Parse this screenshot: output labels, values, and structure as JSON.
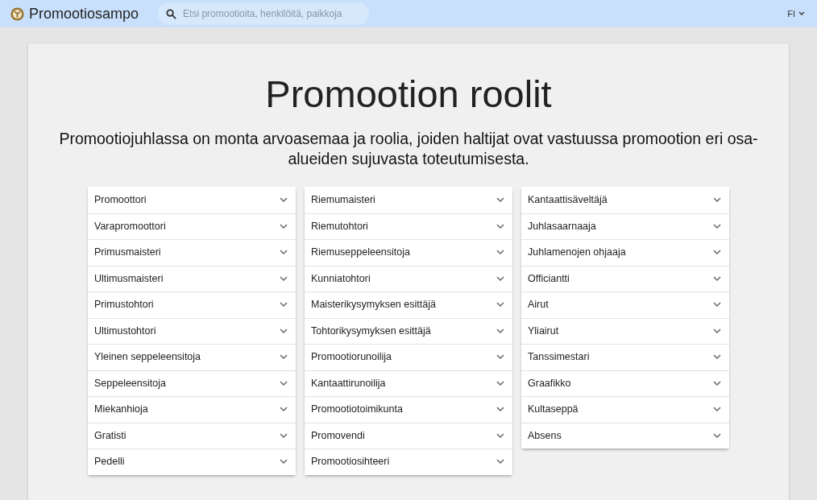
{
  "app_bar": {
    "title": "Promootiosampo",
    "search": {
      "placeholder": "Etsi promootioita, henkilöitä, paikkoja"
    },
    "language": "FI"
  },
  "heading": "Promootion roolit",
  "intro": "Promootiojuhlassa on monta arvoasemaa ja roolia, joiden haltijat ovat vastuussa promootion eri osa-alueiden sujuvasta toteutumisesta.",
  "columns": [
    {
      "items": [
        {
          "label": "Promoottori",
          "expanded": false
        },
        {
          "label": "Varapromoottori",
          "expanded": false
        },
        {
          "label": "Primusmaisteri",
          "expanded": false
        },
        {
          "label": "Ultimusmaisteri",
          "expanded": false
        },
        {
          "label": "Primustohtori",
          "expanded": false
        },
        {
          "label": "Ultimustohtori",
          "expanded": false
        },
        {
          "label": "Yleinen seppeleensitoja",
          "expanded": false
        },
        {
          "label": "Seppeleensitoja",
          "expanded": false
        },
        {
          "label": "Miekanhioja",
          "expanded": false
        },
        {
          "label": "Gratisti",
          "expanded": false
        },
        {
          "label": "Pedelli",
          "expanded": false
        }
      ]
    },
    {
      "items": [
        {
          "label": "Riemumaisteri",
          "expanded": false
        },
        {
          "label": "Riemutohtori",
          "expanded": false
        },
        {
          "label": "Riemuseppeleensitoja",
          "expanded": false
        },
        {
          "label": "Kunniatohtori",
          "expanded": false
        },
        {
          "label": "Maisterikysymyksen esittäjä",
          "expanded": false
        },
        {
          "label": "Tohtorikysymyksen esittäjä",
          "expanded": false
        },
        {
          "label": "Promootiorunoilija",
          "expanded": false
        },
        {
          "label": "Kantaattirunoilija",
          "expanded": false
        },
        {
          "label": "Promootiotoimikunta",
          "expanded": false
        },
        {
          "label": "Promovendi",
          "expanded": false
        },
        {
          "label": "Promootiosihteeri",
          "expanded": false
        }
      ]
    },
    {
      "items": [
        {
          "label": "Kantaattisäveltäjä",
          "expanded": false
        },
        {
          "label": "Juhlasaarnaaja",
          "expanded": false
        },
        {
          "label": "Juhlamenojen ohjaaja",
          "expanded": false
        },
        {
          "label": "Officiantti",
          "expanded": false
        },
        {
          "label": "Airut",
          "expanded": false
        },
        {
          "label": "Yliairut",
          "expanded": false
        },
        {
          "label": "Tanssimestari",
          "expanded": false
        },
        {
          "label": "Graafikko",
          "expanded": false
        },
        {
          "label": "Kultaseppä",
          "expanded": false
        },
        {
          "label": "Absens",
          "expanded": false
        }
      ]
    }
  ]
}
